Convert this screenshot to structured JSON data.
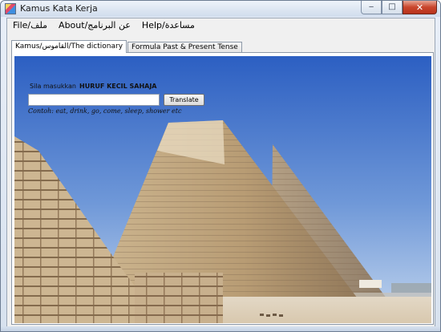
{
  "window": {
    "title": "Kamus Kata Kerja",
    "min_label": "‒",
    "max_label": "□",
    "close_label": "✕"
  },
  "menu": {
    "items": [
      "File/ملف",
      "About/عن البرنامج",
      "Help/مساعدة"
    ]
  },
  "tabs": [
    {
      "label": "Kamus/القاموس/The dictionary",
      "active": true
    },
    {
      "label": "Formula Past & Present Tense",
      "active": false
    }
  ],
  "dictionary": {
    "prompt_prefix": "Sila masukkan",
    "prompt_strong": "HURUF KECIL SAHAJA",
    "input_value": "",
    "input_placeholder": "",
    "translate_label": "Translate",
    "example_text": "Contoh: eat, drink, go, come, sleep, shower etc"
  },
  "icons": {
    "app": "app-icon",
    "minimize": "minimize-icon",
    "maximize": "maximize-icon",
    "close": "close-icon"
  },
  "colors": {
    "sky_top": "#2f63c4",
    "sky_bottom": "#bcd3ee",
    "stone": "#c8b08a",
    "sand": "#e6dccd"
  }
}
